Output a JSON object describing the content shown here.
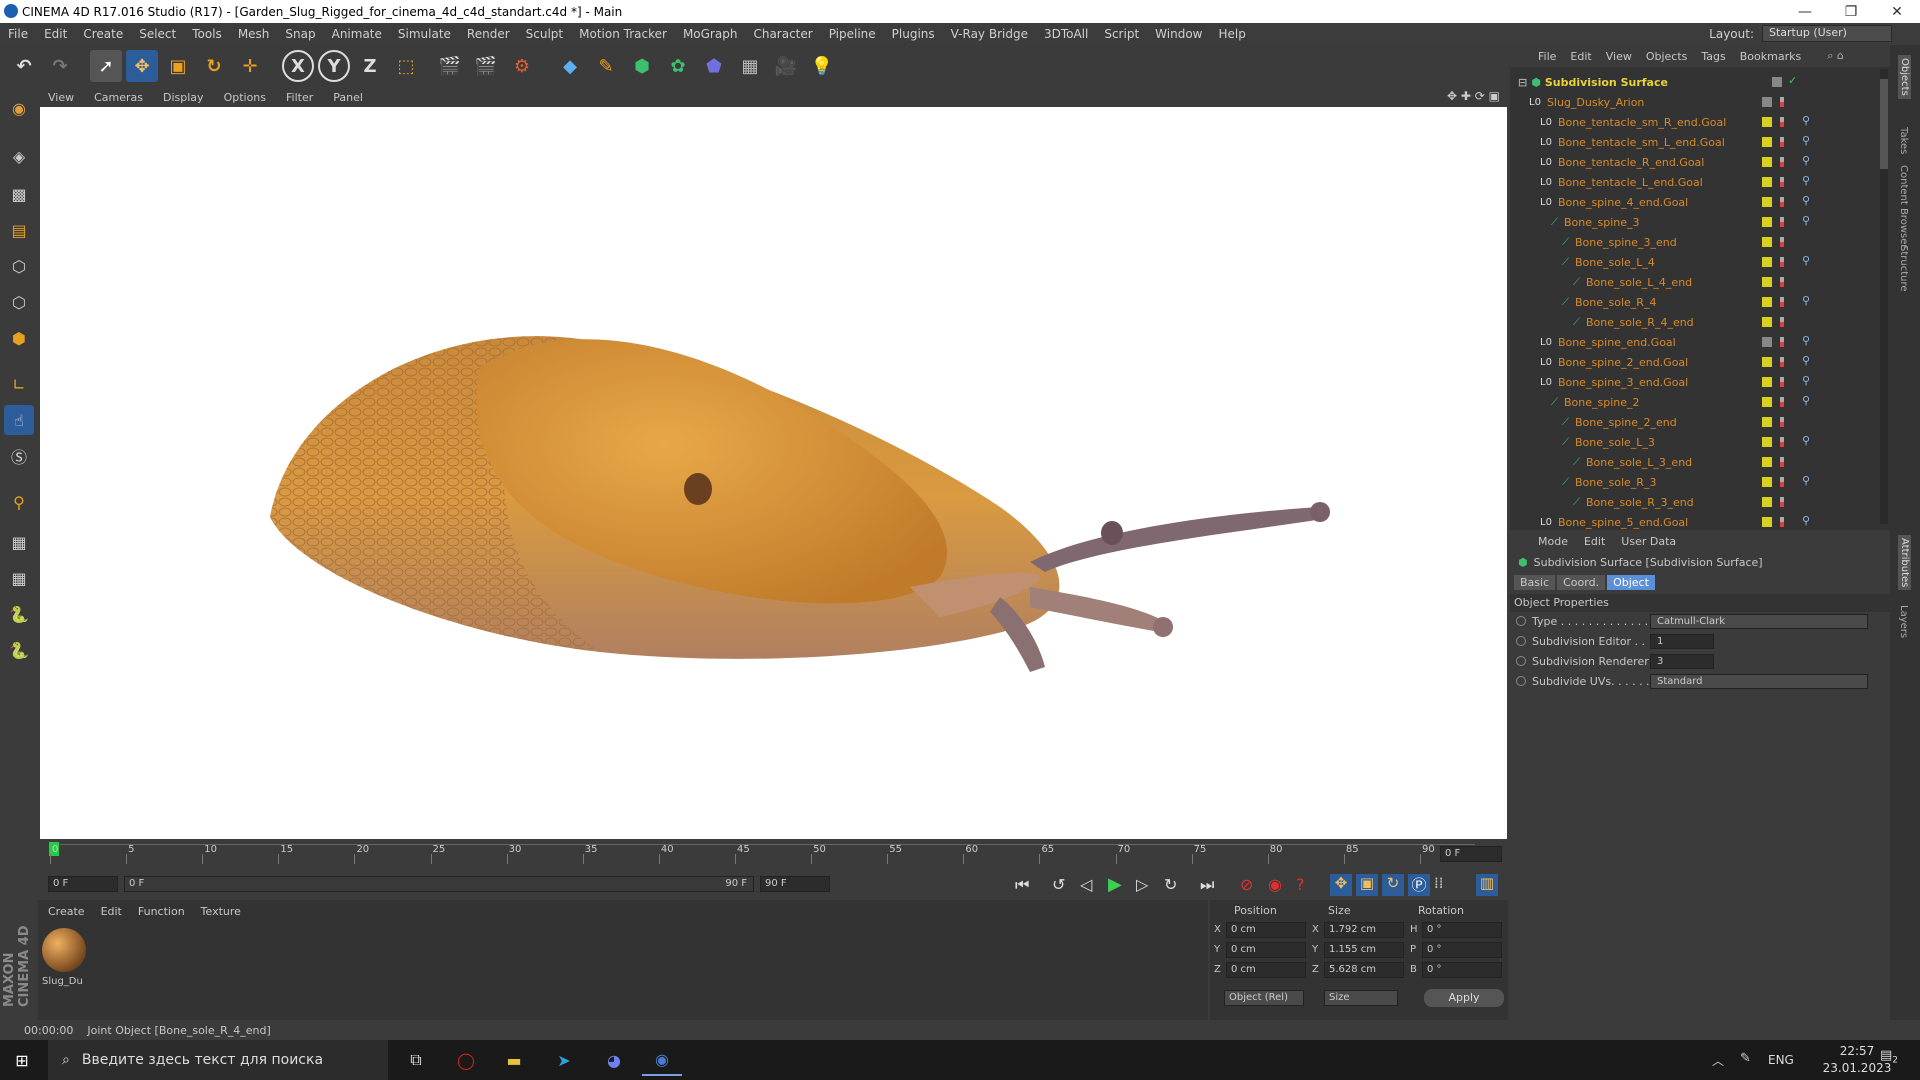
{
  "window": {
    "title": "CINEMA 4D R17.016 Studio (R17) - [Garden_Slug_Rigged_for_cinema_4d_c4d_standart.c4d *] - Main",
    "minimize": "—",
    "maximize": "❐",
    "close": "✕"
  },
  "menu": {
    "items": [
      "File",
      "Edit",
      "Create",
      "Select",
      "Tools",
      "Mesh",
      "Snap",
      "Animate",
      "Simulate",
      "Render",
      "Sculpt",
      "Motion Tracker",
      "MoGraph",
      "Character",
      "Pipeline",
      "Plugins",
      "V-Ray Bridge",
      "3DToAll",
      "Script",
      "Window",
      "Help"
    ],
    "layout_label": "Layout:",
    "layout_value": "Startup (User)"
  },
  "toolbar": {
    "x_label": "X",
    "y_label": "Y",
    "z_label": "Z"
  },
  "viewport": {
    "menu": [
      "View",
      "Cameras",
      "Display",
      "Options",
      "Filter",
      "Panel"
    ]
  },
  "timeline": {
    "ticks": [
      "0",
      "5",
      "10",
      "15",
      "20",
      "25",
      "30",
      "35",
      "40",
      "45",
      "50",
      "55",
      "60",
      "65",
      "70",
      "75",
      "80",
      "85",
      "90"
    ],
    "end_frame": "0 F",
    "start_field": "0 F",
    "range_start": "0 F",
    "range_end": "90 F",
    "max_field": "90 F"
  },
  "material_manager": {
    "menu": [
      "Create",
      "Edit",
      "Function",
      "Texture"
    ],
    "material_name": "Slug_Du"
  },
  "coordinates": {
    "headers": [
      "Position",
      "Size",
      "Rotation"
    ],
    "rows": [
      {
        "axis": "X",
        "pos": "0 cm",
        "size_axis": "X",
        "size": "1.792 cm",
        "rot_axis": "H",
        "rot": "0 °"
      },
      {
        "axis": "Y",
        "pos": "0 cm",
        "size_axis": "Y",
        "size": "1.155 cm",
        "rot_axis": "P",
        "rot": "0 °"
      },
      {
        "axis": "Z",
        "pos": "0 cm",
        "size_axis": "Z",
        "size": "5.628 cm",
        "rot_axis": "B",
        "rot": "0 °"
      }
    ],
    "mode": "Object (Rel)",
    "size_mode": "Size",
    "apply": "Apply"
  },
  "status": {
    "time": "00:00:00",
    "message": "Joint Object [Bone_sole_R_4_end]"
  },
  "object_manager": {
    "menu": [
      "File",
      "Edit",
      "View",
      "Objects",
      "Tags",
      "Bookmarks"
    ],
    "root": "Subdivision Surface",
    "items": [
      {
        "name": "Slug_Dusky_Arion",
        "indent": 1
      },
      {
        "name": "Bone_tentacle_sm_R_end.Goal",
        "indent": 2
      },
      {
        "name": "Bone_tentacle_sm_L_end.Goal",
        "indent": 2
      },
      {
        "name": "Bone_tentacle_R_end.Goal",
        "indent": 2
      },
      {
        "name": "Bone_tentacle_L_end.Goal",
        "indent": 2
      },
      {
        "name": "Bone_spine_4_end.Goal",
        "indent": 2
      },
      {
        "name": "Bone_spine_3",
        "indent": 3
      },
      {
        "name": "Bone_spine_3_end",
        "indent": 4
      },
      {
        "name": "Bone_sole_L_4",
        "indent": 4
      },
      {
        "name": "Bone_sole_L_4_end",
        "indent": 5
      },
      {
        "name": "Bone_sole_R_4",
        "indent": 4
      },
      {
        "name": "Bone_sole_R_4_end",
        "indent": 5
      },
      {
        "name": "Bone_spine_end.Goal",
        "indent": 2
      },
      {
        "name": "Bone_spine_2_end.Goal",
        "indent": 2
      },
      {
        "name": "Bone_spine_3_end.Goal",
        "indent": 2
      },
      {
        "name": "Bone_spine_2",
        "indent": 3
      },
      {
        "name": "Bone_spine_2_end",
        "indent": 4
      },
      {
        "name": "Bone_sole_L_3",
        "indent": 4
      },
      {
        "name": "Bone_sole_L_3_end",
        "indent": 5
      },
      {
        "name": "Bone_sole_R_3",
        "indent": 4
      },
      {
        "name": "Bone_sole_R_3_end",
        "indent": 5
      },
      {
        "name": "Bone_spine_5_end.Goal",
        "indent": 2
      }
    ]
  },
  "attributes": {
    "menu": [
      "Mode",
      "Edit",
      "User Data"
    ],
    "header": "Subdivision Surface [Subdivision Surface]",
    "tabs": [
      "Basic",
      "Coord.",
      "Object"
    ],
    "section": "Object Properties",
    "props": [
      {
        "label": "Type . . . . . . . . . . . . . .",
        "value": "Catmull-Clark",
        "kind": "select"
      },
      {
        "label": "Subdivision Editor . .",
        "value": "1",
        "kind": "number"
      },
      {
        "label": "Subdivision Renderer",
        "value": "3",
        "kind": "number"
      },
      {
        "label": "Subdivide UVs. . . . . .",
        "value": "Standard",
        "kind": "select"
      }
    ]
  },
  "right_tabs": [
    "Objects",
    "Takes",
    "Content Browser",
    "Structure"
  ],
  "right_tabs_lower": [
    "Attributes",
    "Layers"
  ],
  "taskbar": {
    "search_placeholder": "Введите здесь текст для поиска",
    "lang": "ENG",
    "time": "22:57",
    "date": "23.01.2023",
    "notif": "2"
  },
  "branding": "MAXON CINEMA 4D",
  "colors": {
    "accent": "#5b8fd6",
    "object_orange": "#d98a2a",
    "root_yellow": "#e8d23a"
  }
}
